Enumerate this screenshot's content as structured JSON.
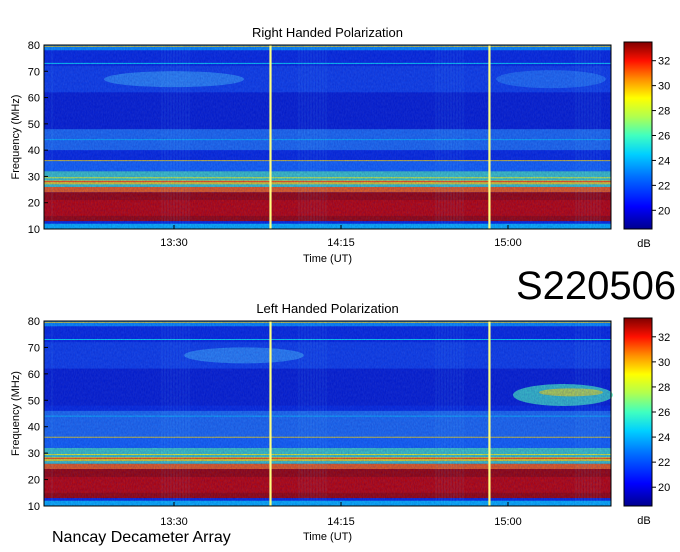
{
  "observation_id": "S220506",
  "instrument": "Nancay Decameter Array",
  "colormap": [
    "#00008f",
    "#0000ff",
    "#0060ff",
    "#00c0ff",
    "#40ffc0",
    "#a0ff60",
    "#ffff00",
    "#ff9000",
    "#ff2000",
    "#a00000",
    "#800000"
  ],
  "chart_data": [
    {
      "type": "heatmap",
      "title": "Right Handed Polarization",
      "xlabel": "Time (UT)",
      "ylabel": "Frequency (MHz)",
      "x_ticks": [
        "13:30",
        "14:15",
        "15:00"
      ],
      "y_ticks": [
        10,
        20,
        30,
        40,
        50,
        60,
        70,
        80
      ],
      "ylim": [
        10,
        80
      ],
      "colorbar": {
        "label": "dB",
        "ticks": [
          20,
          22,
          24,
          26,
          28,
          30,
          32
        ],
        "range": [
          18.5,
          33.5
        ]
      },
      "features": {
        "strong_band_mhz": [
          13,
          24
        ],
        "emission_band_mhz": [
          26,
          32
        ],
        "faint_band_mhz": [
          40,
          48
        ],
        "dark_band_mhz": [
          48,
          62
        ],
        "upper_patch_mhz": [
          62,
          72
        ],
        "vertical_lines_ut": [
          "13:56",
          "14:55"
        ]
      }
    },
    {
      "type": "heatmap",
      "title": "Left Handed Polarization",
      "xlabel": "Time (UT)",
      "ylabel": "Frequency (MHz)",
      "x_ticks": [
        "13:30",
        "14:15",
        "15:00"
      ],
      "y_ticks": [
        10,
        20,
        30,
        40,
        50,
        60,
        70,
        80
      ],
      "ylim": [
        10,
        80
      ],
      "colorbar": {
        "label": "dB",
        "ticks": [
          20,
          22,
          24,
          26,
          28,
          30,
          32
        ],
        "range": [
          18.5,
          33.5
        ]
      },
      "features": {
        "strong_band_mhz": [
          13,
          24
        ],
        "emission_band_mhz": [
          26,
          32
        ],
        "faint_band_mhz": [
          36,
          46
        ],
        "dark_band_mhz": [
          48,
          62
        ],
        "upper_patch_mhz": [
          62,
          72
        ],
        "late_burst_mhz": [
          46,
          58
        ],
        "vertical_lines_ut": [
          "13:56",
          "14:55"
        ]
      }
    }
  ]
}
